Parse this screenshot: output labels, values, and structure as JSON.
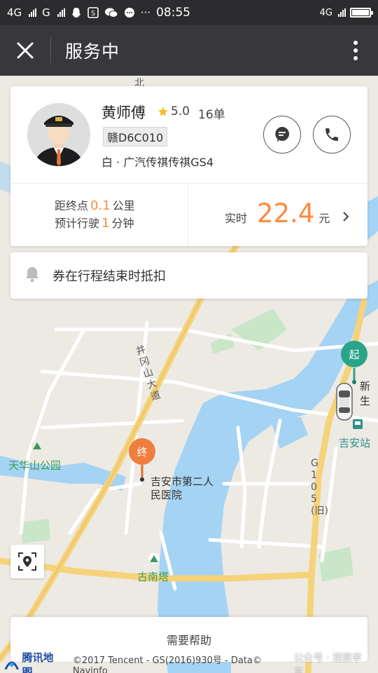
{
  "status_bar": {
    "left_signal_1": "4G",
    "left_signal_2": "G",
    "more_dots": "···",
    "time": "08:55",
    "right_signal": "4G"
  },
  "app_bar": {
    "title": "服务中"
  },
  "driver": {
    "name": "黄师傅",
    "rating": "5.0",
    "orders": "16单",
    "plate": "赣D6C010",
    "car": "白 · 广汽传祺传祺GS4"
  },
  "trip": {
    "distance_prefix": "距终点",
    "distance_value": "0.1",
    "distance_unit": "公里",
    "eta_prefix": "预计行驶",
    "eta_value": "1",
    "eta_unit": "分钟"
  },
  "fare": {
    "label": "实时",
    "value": "22.4",
    "unit": "元"
  },
  "coupon": {
    "text": "券在行程结束时抵扣"
  },
  "map": {
    "start_marker": "起",
    "end_marker": "终",
    "labels": {
      "park": "天华山公园",
      "hospital_line1": "吉安市第二人",
      "hospital_line2": "民医院",
      "tower": "古南塔",
      "station": "吉安站",
      "xin": "新生",
      "road_jinggang": "井冈山大道",
      "road_g105": "G105(旧)",
      "road_top": "北"
    },
    "colors": {
      "water": "#a5d3f3",
      "land": "#eceae3",
      "major_road": "#f6d27a",
      "minor_road": "#ffffff",
      "green": "#c9e6c8"
    }
  },
  "help": {
    "label": "需要帮助"
  },
  "footer": {
    "logo": "腾讯地图",
    "copyright": "©2017 Tencent - GS(2016)930号 - Data© Navinfo",
    "watermark": "公众号 · 观察孝言"
  }
}
